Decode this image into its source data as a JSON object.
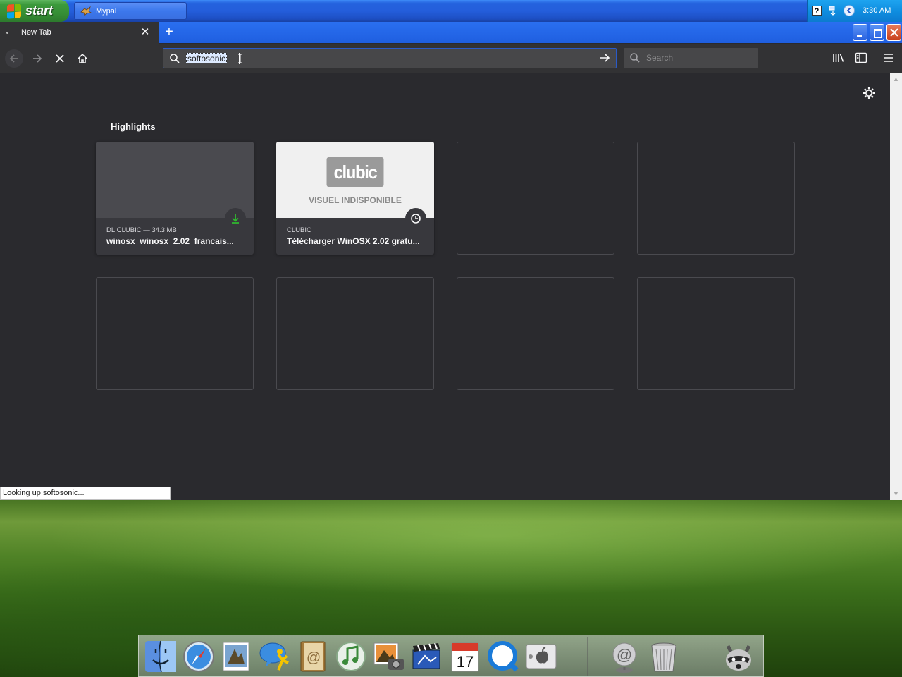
{
  "taskbar": {
    "start_label": "start",
    "task_label": "Mypal",
    "clock": "3:30 AM"
  },
  "browser": {
    "tab": {
      "label": "New Tab"
    },
    "url": {
      "value": "softosonic"
    },
    "search": {
      "placeholder": "Search"
    },
    "highlights_title": "Highlights",
    "cards": [
      {
        "host": "DL.CLUBIC — 34.3 MB",
        "title": "winosx_winosx_2.02_francais...",
        "badge": "download-icon"
      },
      {
        "host": "CLUBIC",
        "title": "Télécharger WinOSX 2.02 gratu...",
        "badge": "clock-icon",
        "logo": "clubic",
        "placeholder_text": "VISUEL INDISPONIBLE"
      }
    ],
    "status": "Looking up softosonic..."
  },
  "colors": {
    "content_bg": "#2a2a2e",
    "toolbar_bg": "#323234",
    "xp_blue": "#245edb",
    "start_green": "#3c9a3c",
    "download_green": "#2fb82f"
  },
  "dock": {
    "items": [
      "finder-icon",
      "safari-icon",
      "preview-icon",
      "ichat-icon",
      "address-book-icon",
      "itunes-icon",
      "iphoto-icon",
      "imovie-icon",
      "ical-icon",
      "quicktime-icon",
      "system-preferences-icon",
      "mail-icon",
      "trash-icon",
      "raccoon-icon"
    ],
    "ical_day": "17"
  }
}
